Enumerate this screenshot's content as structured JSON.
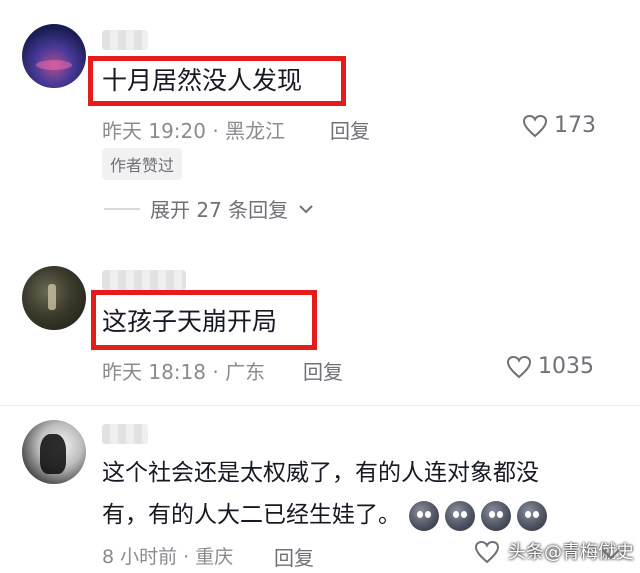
{
  "comments": [
    {
      "text": "十月居然没人发现",
      "meta": "昨天 19:20 · 黑龙江",
      "reply_label": "回复",
      "likes": "173",
      "badge": "作者赞过",
      "expand_label": "展开 27 条回复"
    },
    {
      "text": "这孩子天崩开局",
      "meta": "昨天 18:18 · 广东",
      "reply_label": "回复",
      "likes": "1035"
    },
    {
      "text_line1": "这个社会还是太权威了，有的人连对象都没",
      "text_line2": "有，有的人大二已经生娃了。",
      "meta": "8 小时前 · 重庆",
      "reply_label": "回复"
    }
  ],
  "watermark": "头条@青梅僦史",
  "icons": {
    "heart": "heart-icon",
    "chevron": "chevron-down-icon",
    "share": "share-icon"
  },
  "colors": {
    "highlight_box": "#e51c1c",
    "secondary_text": "#8a8b91"
  }
}
